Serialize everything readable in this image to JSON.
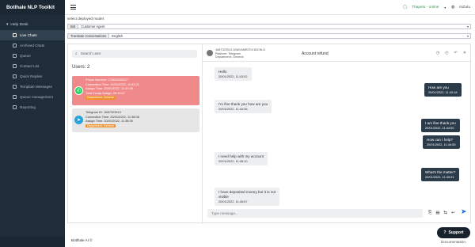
{
  "app": {
    "title": "Botlhale NLP Toolkit"
  },
  "sidebar": {
    "section": "Help Desk",
    "items": [
      {
        "label": "Live Chats",
        "active": true
      },
      {
        "label": "Archived Chats"
      },
      {
        "label": "Queue"
      },
      {
        "label": "Contact List"
      },
      {
        "label": "Quick Replies"
      },
      {
        "label": "Template Messages"
      },
      {
        "label": "Queue management"
      },
      {
        "label": "Reporting"
      }
    ]
  },
  "topbar": {
    "user": "Thapelo - online",
    "language": "isiZulu"
  },
  "controls": {
    "deployed_label": "select deployed model:",
    "bot_prefix": "Bot",
    "bot_value": "Customer Agent",
    "translate_prefix": "Translate Conversations",
    "translate_value": "English"
  },
  "search": {
    "placeholder": "Search user"
  },
  "users_count": "Users: 2",
  "cards": [
    {
      "phone": "Phone Number: 278620089227",
      "connection": "Connection Time: 20/01/2022, 11:31:01",
      "assign": "Assign Time: 20/01/2022, 11:41:08",
      "total": "Total Escap Assign: 00:10:07",
      "badge": "Department: General",
      "channel": "whatsapp"
    },
    {
      "phone": "Telegram ID: 1687323913",
      "connection": "Connection Time: 20/01/2022, 11:38:08",
      "assign": "Assign Time: 20/01/2022, 11:38:39",
      "badge": "Department: General",
      "channel": "telegram"
    }
  ],
  "chat_header": {
    "id": "1687323913-GBAYAMBTDV1BCNLG",
    "platform": "Platform: Telegram",
    "department": "Department: General",
    "title": "Account refund"
  },
  "messages": [
    {
      "dir": "in",
      "text": "Hello",
      "time": "20/01/2022, 11:43:02"
    },
    {
      "dir": "out",
      "text": "How are you",
      "time": "20/01/2022, 11:43:18"
    },
    {
      "dir": "in",
      "text": "I'm fine thank you how are you",
      "time": "20/01/2022, 11:44:36"
    },
    {
      "dir": "out",
      "text": "I am fine thank you",
      "time": "20/01/2022, 11:44:50"
    },
    {
      "dir": "out",
      "text": "How can I help?",
      "time": "20/01/2022, 11:44:55"
    },
    {
      "dir": "in",
      "text": "I need help with my account",
      "time": "20/01/2022, 11:45:10"
    },
    {
      "dir": "out",
      "text": "What's the matter?",
      "time": "20/01/2022, 11:45:31"
    },
    {
      "dir": "in",
      "text": "I have deposited money but it is not",
      "text2": "visible",
      "time": "20/01/2022, 11:45:57"
    }
  ],
  "composer": {
    "placeholder": "Type message..."
  },
  "footer": {
    "text": "Botlhale AI ©",
    "support": "Support",
    "documentation": "Documentation"
  }
}
